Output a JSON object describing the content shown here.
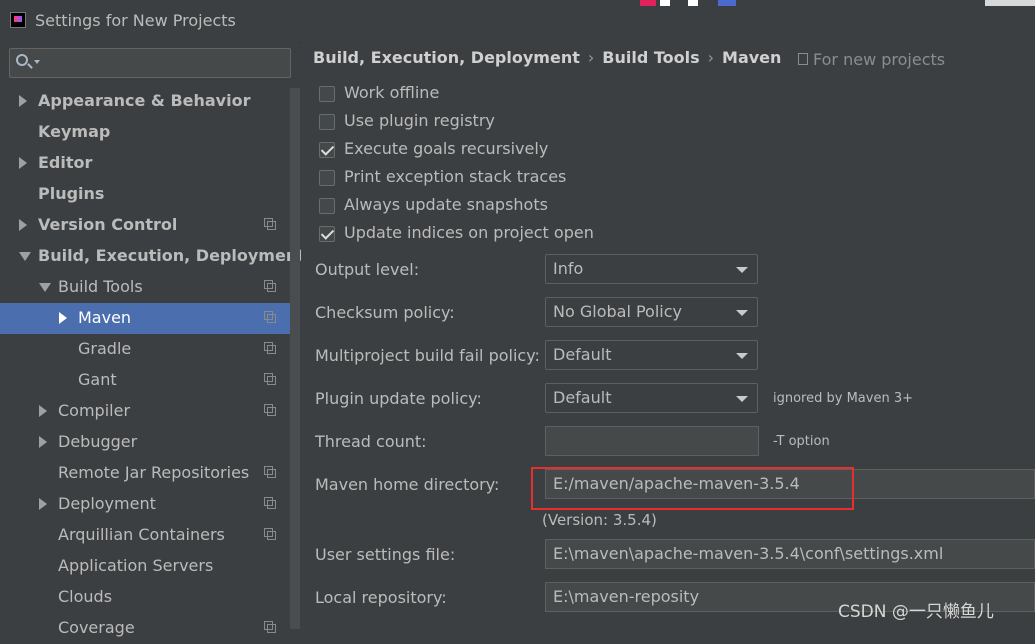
{
  "window": {
    "title": "Settings for New Projects"
  },
  "search": {
    "placeholder": ""
  },
  "sidebar": {
    "items": [
      {
        "label": "Appearance & Behavior",
        "arrow": "right",
        "bold": true,
        "copy": false
      },
      {
        "label": "Keymap",
        "arrow": "",
        "bold": true,
        "copy": false
      },
      {
        "label": "Editor",
        "arrow": "right",
        "bold": true,
        "copy": false
      },
      {
        "label": "Plugins",
        "arrow": "",
        "bold": true,
        "copy": false
      },
      {
        "label": "Version Control",
        "arrow": "right",
        "bold": true,
        "copy": true
      },
      {
        "label": "Build, Execution, Deployment",
        "arrow": "down",
        "bold": true,
        "copy": false
      },
      {
        "label": "Build Tools",
        "arrow": "down",
        "bold": false,
        "copy": true
      },
      {
        "label": "Maven",
        "arrow": "right",
        "bold": false,
        "copy": true,
        "selected": true
      },
      {
        "label": "Gradle",
        "arrow": "",
        "bold": false,
        "copy": true
      },
      {
        "label": "Gant",
        "arrow": "",
        "bold": false,
        "copy": true
      },
      {
        "label": "Compiler",
        "arrow": "right",
        "bold": false,
        "copy": true
      },
      {
        "label": "Debugger",
        "arrow": "right",
        "bold": false,
        "copy": false
      },
      {
        "label": "Remote Jar Repositories",
        "arrow": "",
        "bold": false,
        "copy": true
      },
      {
        "label": "Deployment",
        "arrow": "right",
        "bold": false,
        "copy": true
      },
      {
        "label": "Arquillian Containers",
        "arrow": "",
        "bold": false,
        "copy": true
      },
      {
        "label": "Application Servers",
        "arrow": "",
        "bold": false,
        "copy": false
      },
      {
        "label": "Clouds",
        "arrow": "",
        "bold": false,
        "copy": false
      },
      {
        "label": "Coverage",
        "arrow": "",
        "bold": false,
        "copy": true
      }
    ]
  },
  "breadcrumb": {
    "part1": "Build, Execution, Deployment",
    "part2": "Build Tools",
    "part3": "Maven",
    "separator": "›"
  },
  "scope": {
    "label": "For new projects"
  },
  "checkboxes": [
    {
      "label": "Work offline",
      "checked": false
    },
    {
      "label": "Use plugin registry",
      "checked": false
    },
    {
      "label": "Execute goals recursively",
      "checked": true
    },
    {
      "label": "Print exception stack traces",
      "checked": false
    },
    {
      "label": "Always update snapshots",
      "checked": false
    },
    {
      "label": "Update indices on project open",
      "checked": true
    }
  ],
  "fields": {
    "output_level": {
      "label": "Output level:",
      "value": "Info"
    },
    "checksum_policy": {
      "label": "Checksum policy:",
      "value": "No Global Policy"
    },
    "multiproject_policy": {
      "label": "Multiproject build fail policy:",
      "value": "Default"
    },
    "plugin_update_policy": {
      "label": "Plugin update policy:",
      "value": "Default",
      "note": "ignored by Maven 3+"
    },
    "thread_count": {
      "label": "Thread count:",
      "value": "",
      "note": "-T option"
    },
    "maven_home": {
      "label": "Maven home directory:",
      "value": "E:/maven/apache-maven-3.5.4",
      "version": "(Version: 3.5.4)"
    },
    "user_settings": {
      "label": "User settings file:",
      "value": "E:\\maven\\apache-maven-3.5.4\\conf\\settings.xml"
    },
    "local_repo": {
      "label": "Local repository:",
      "value": "E:\\maven-reposity"
    }
  },
  "watermark": {
    "text": "CSDN @一只懒鱼儿"
  },
  "colors": {
    "selection": "#4b6eaf",
    "highlight_box": "#e63030",
    "background": "#3c3f41"
  }
}
